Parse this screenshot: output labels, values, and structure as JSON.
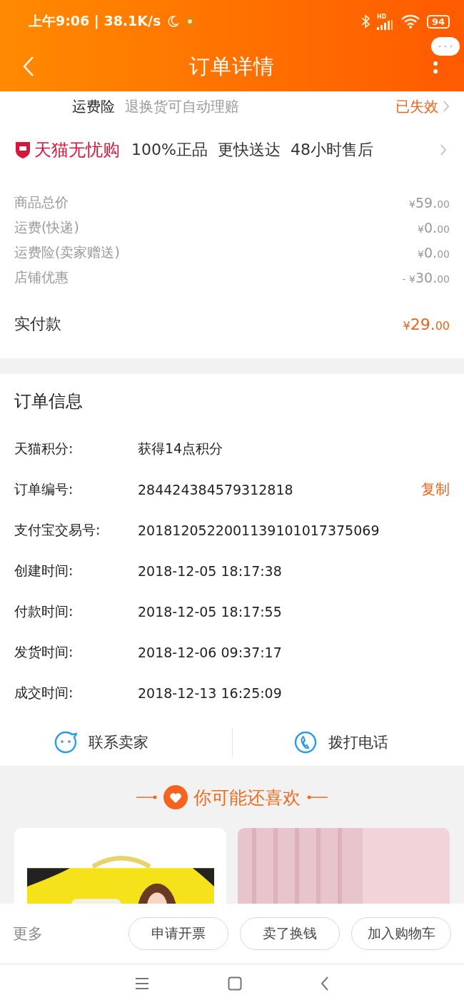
{
  "status_bar": {
    "time_speed": "上午9:06 | 38.1K/s",
    "network": "HD",
    "battery": "94"
  },
  "header": {
    "title": "订单详情"
  },
  "insurance": {
    "name": "运费险",
    "description": "退换货可自动理赔",
    "status": "已失效"
  },
  "guarantee": {
    "brand": "天猫无忧购",
    "features": [
      "100%正品",
      "更快送达",
      "48小时售后"
    ]
  },
  "price_rows": [
    {
      "label": "商品总价",
      "currency": "¥",
      "integer": "59.",
      "fraction": "00"
    },
    {
      "label": "运费(快递)",
      "currency": "¥",
      "integer": "0.",
      "fraction": "00"
    },
    {
      "label": "运费险(卖家赠送)",
      "currency": "¥",
      "integer": "0.",
      "fraction": "00"
    },
    {
      "label": "店铺优惠",
      "sign": "-",
      "currency": "¥",
      "integer": "30.",
      "fraction": "00"
    }
  ],
  "total": {
    "label": "实付款",
    "currency": "¥",
    "integer": "29.",
    "fraction": "00"
  },
  "order_info": {
    "title": "订单信息",
    "rows": [
      {
        "label": "天猫积分:",
        "value": "获得14点积分"
      },
      {
        "label": "订单编号:",
        "value": "284424384579312818",
        "action": "复制"
      },
      {
        "label": "支付宝交易号:",
        "value": "2018120522001139101017375069"
      },
      {
        "label": "创建时间:",
        "value": "2018-12-05 18:17:38"
      },
      {
        "label": "付款时间:",
        "value": "2018-12-05 18:17:55"
      },
      {
        "label": "发货时间:",
        "value": "2018-12-06 09:37:17"
      },
      {
        "label": "成交时间:",
        "value": "2018-12-13 16:25:09"
      }
    ]
  },
  "contact": [
    {
      "kind": "chat",
      "label": "联系卖家"
    },
    {
      "kind": "phone",
      "label": "拨打电话"
    }
  ],
  "recommend": {
    "title": "你可能还喜欢"
  },
  "action_bar": {
    "more": "更多",
    "buttons": [
      "申请开票",
      "卖了换钱",
      "加入购物车"
    ]
  }
}
